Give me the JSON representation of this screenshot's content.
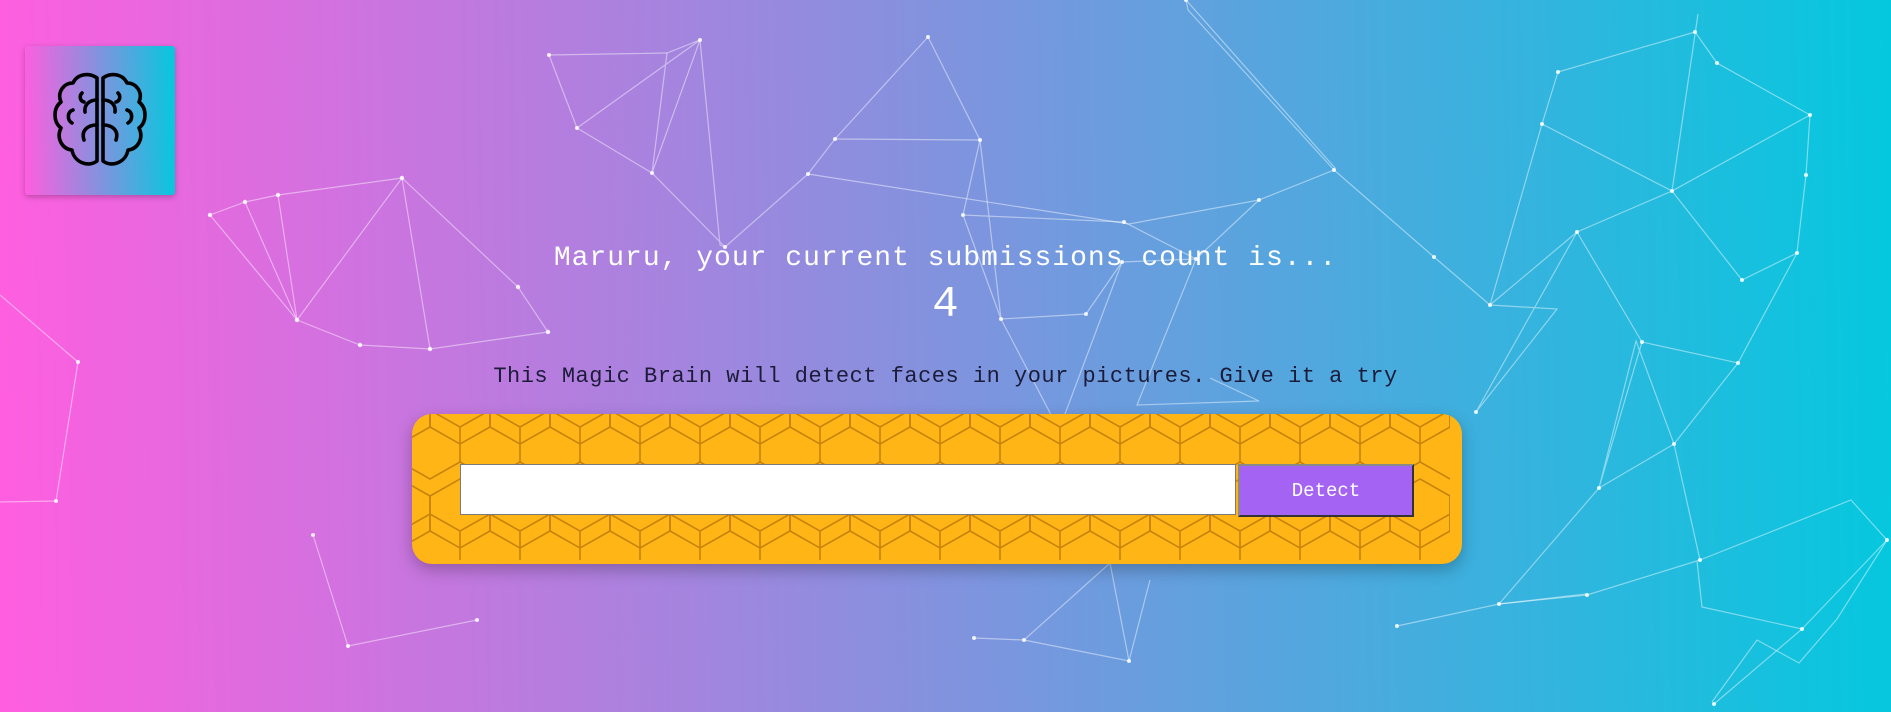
{
  "app": {
    "logo_icon": "brain-icon"
  },
  "rank": {
    "greeting": "Maruru, your current submissions count is...",
    "count": "4"
  },
  "form": {
    "description": "This Magic Brain will detect faces in your pictures. Give it a try",
    "input_value": "",
    "detect_label": "Detect"
  },
  "colors": {
    "gradient_start": "#ff5edf",
    "gradient_end": "#04c8de",
    "panel": "#ffb515",
    "button": "#a463f2"
  }
}
